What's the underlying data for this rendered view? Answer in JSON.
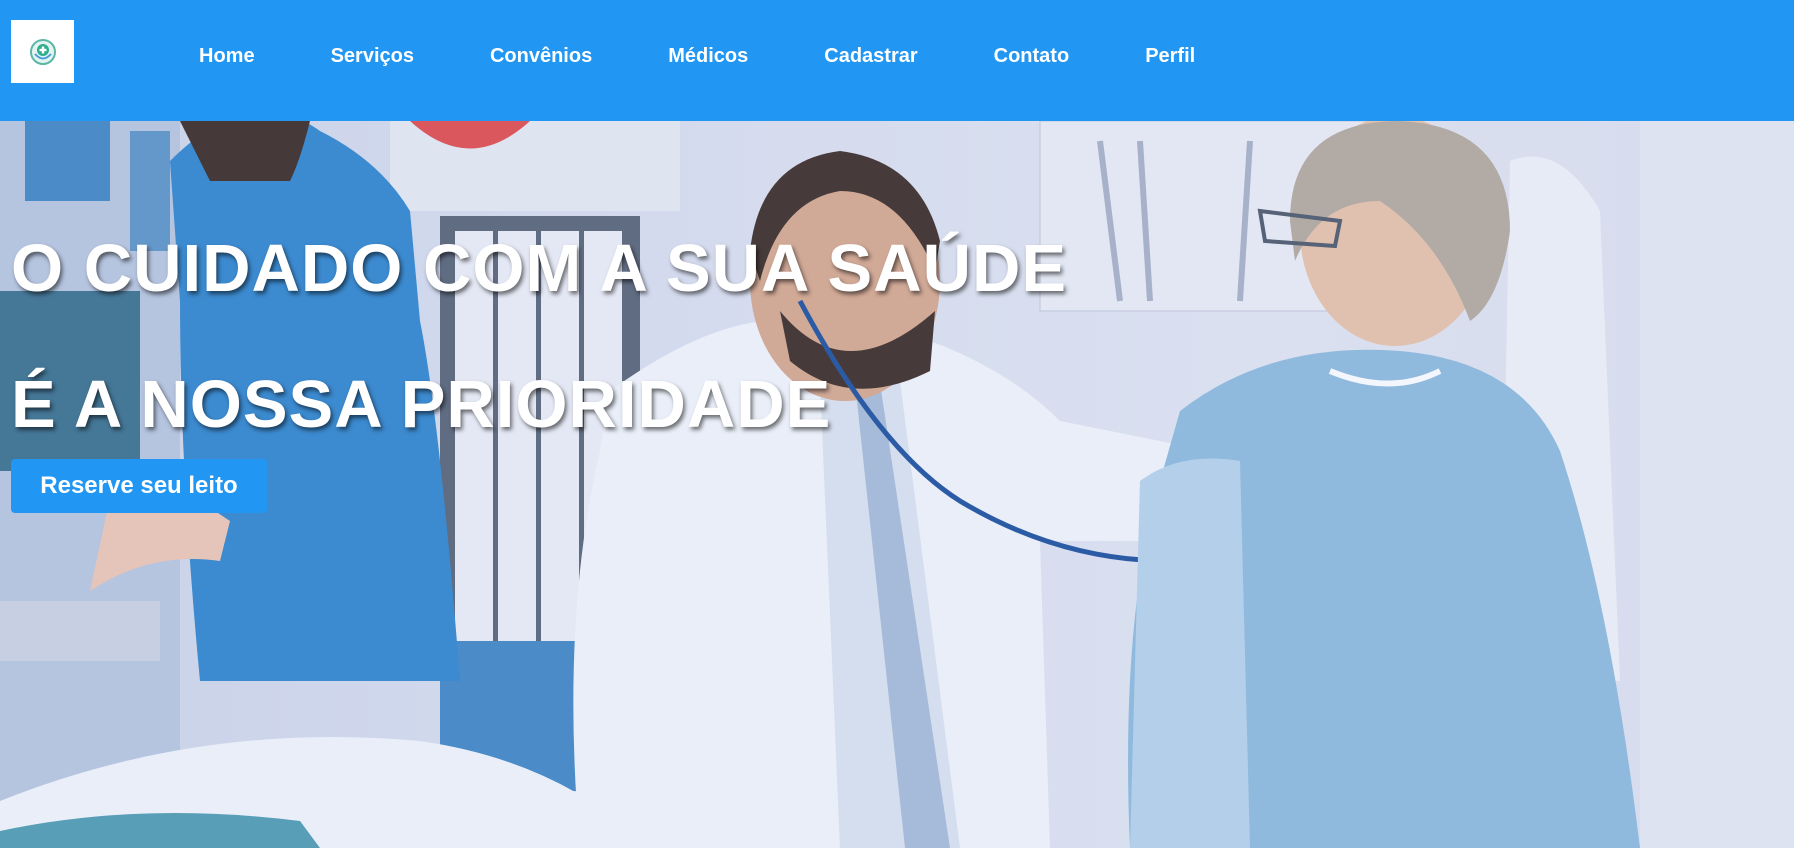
{
  "header": {
    "logo_icon": "hospital-cross-icon",
    "nav": [
      {
        "label": "Home"
      },
      {
        "label": "Serviços"
      },
      {
        "label": "Convênios"
      },
      {
        "label": "Médicos"
      },
      {
        "label": "Cadastrar"
      },
      {
        "label": "Contato"
      },
      {
        "label": "Perfil"
      }
    ]
  },
  "hero": {
    "headline_line1": "O CUIDADO COM A SUA SAÚDE",
    "headline_line2": "É A NOSSA PRIORIDADE",
    "cta_label": "Reserve seu leito"
  },
  "colors": {
    "brand_blue": "#2196f3",
    "text_white": "#ffffff"
  }
}
